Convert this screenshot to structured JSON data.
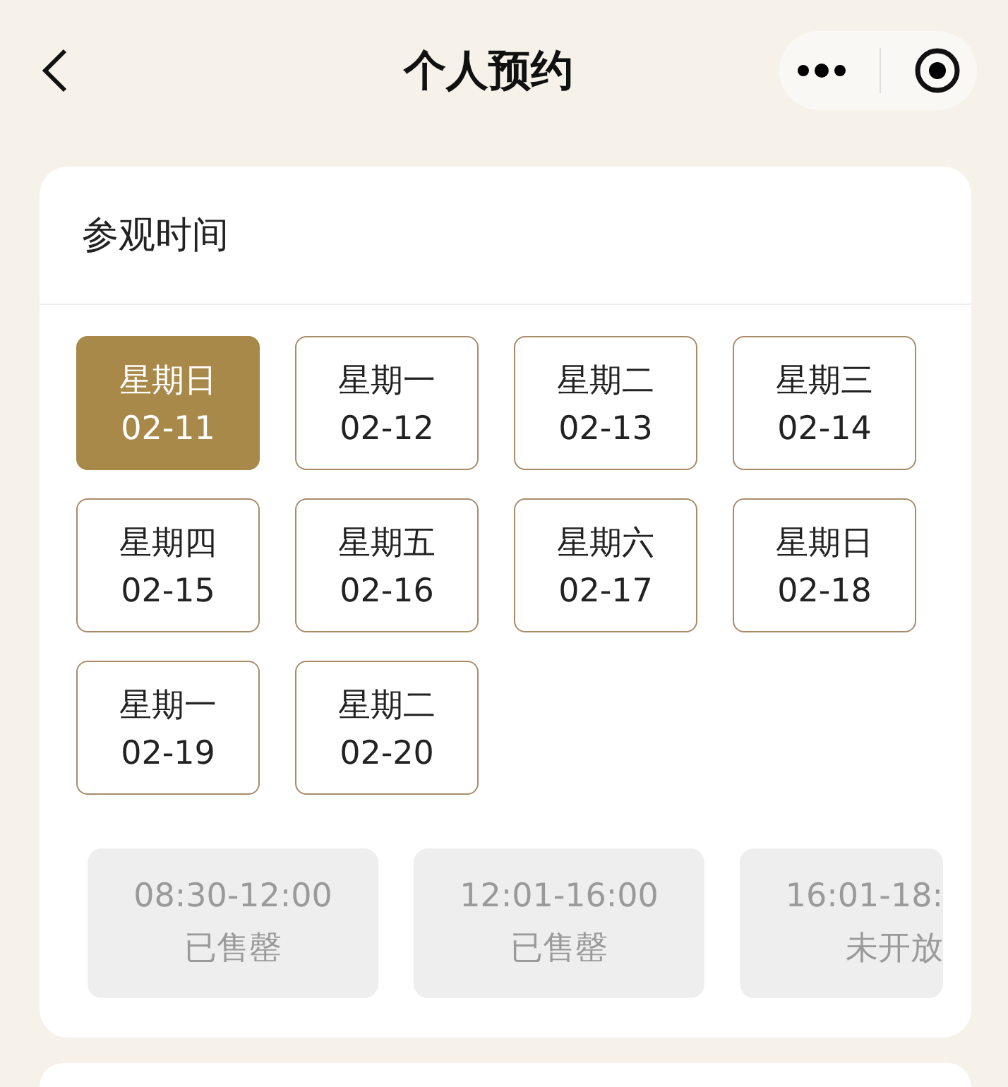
{
  "header": {
    "title": "个人预约"
  },
  "section": {
    "title": "参观时间"
  },
  "dates": [
    {
      "weekday": "星期日",
      "date": "02-11",
      "selected": true
    },
    {
      "weekday": "星期一",
      "date": "02-12",
      "selected": false
    },
    {
      "weekday": "星期二",
      "date": "02-13",
      "selected": false
    },
    {
      "weekday": "星期三",
      "date": "02-14",
      "selected": false
    },
    {
      "weekday": "星期四",
      "date": "02-15",
      "selected": false
    },
    {
      "weekday": "星期五",
      "date": "02-16",
      "selected": false
    },
    {
      "weekday": "星期六",
      "date": "02-17",
      "selected": false
    },
    {
      "weekday": "星期日",
      "date": "02-18",
      "selected": false
    },
    {
      "weekday": "星期一",
      "date": "02-19",
      "selected": false
    },
    {
      "weekday": "星期二",
      "date": "02-20",
      "selected": false
    }
  ],
  "time_slots": [
    {
      "time": "08:30-12:00",
      "status": "已售罄",
      "disabled": true
    },
    {
      "time": "12:01-16:00",
      "status": "已售罄",
      "disabled": true
    },
    {
      "time": "16:01-18:",
      "status": "未开放",
      "disabled": true
    }
  ]
}
